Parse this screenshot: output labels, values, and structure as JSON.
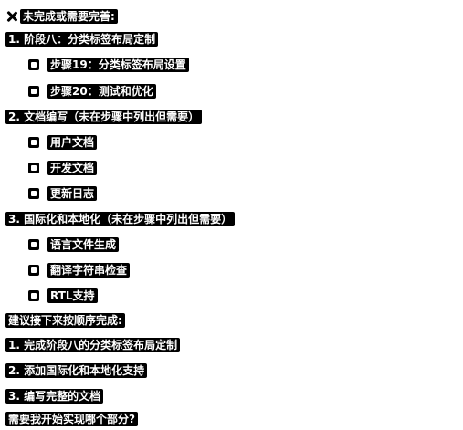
{
  "header": {
    "icon": "close-x-icon",
    "title": "未完成或需要完善:"
  },
  "sections": [
    {
      "heading": "1. 阶段八：分类标签布局定制",
      "items": [
        "步骤19：分类标签布局设置",
        "步骤20：测试和优化"
      ]
    },
    {
      "heading": "2. 文档编写（未在步骤中列出但需要）",
      "items": [
        "用户文档",
        "开发文档",
        "更新日志"
      ]
    },
    {
      "heading": "3. 国际化和本地化（未在步骤中列出但需要）",
      "items": [
        "语言文件生成",
        "翻译字符串检查",
        "RTL支持"
      ]
    }
  ],
  "recommendation": {
    "title": "建议接下来按顺序完成:",
    "steps": [
      "1. 完成阶段八的分类标签布局定制",
      "2. 添加国际化和本地化支持",
      "3. 编写完整的文档"
    ]
  },
  "question": "需要我开始实现哪个部分?"
}
